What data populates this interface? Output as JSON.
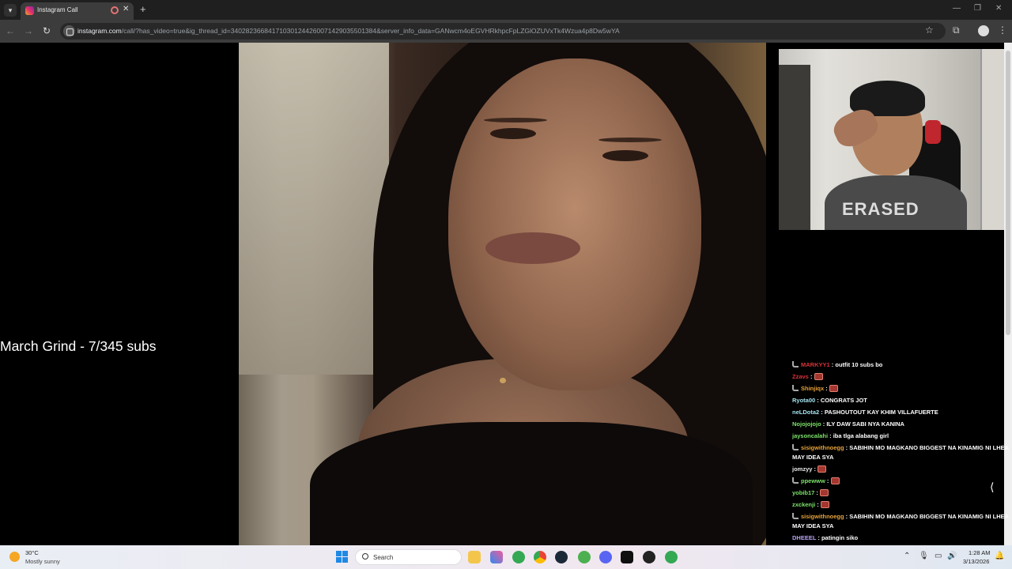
{
  "browser": {
    "tab_title": "Instagram Call",
    "url_host": "instagram.com",
    "url_path": "/call/?has_video=true&ig_thread_id=340282366841710301244260071429035501384&server_info_data=GANwcm4oEGVHRkhpcFpLZGlOZUVxTk4Wzua4p8Dw5wYA"
  },
  "stream": {
    "overlay_text": "March Grind - 7/345 subs"
  },
  "chat": {
    "messages": [
      {
        "user": "MARKYY1",
        "color": "#d9323a",
        "badge": true,
        "text": "outfit 10 subs bo",
        "emote": false
      },
      {
        "user": "Zzavs",
        "color": "#d9323a",
        "badge": false,
        "text": "",
        "emote": true
      },
      {
        "user": "Shinjiqx",
        "color": "#e8a33a",
        "badge": true,
        "text": "",
        "emote": true
      },
      {
        "user": "Ryota00",
        "color": "#a4e3f0",
        "badge": false,
        "text": "CONGRATS JOT",
        "emote": false
      },
      {
        "user": "neLDota2",
        "color": "#a4e3f0",
        "badge": false,
        "text": "PASHOUTOUT KAY KHIM VILLAFUERTE",
        "emote": false
      },
      {
        "user": "Nojojojojo",
        "color": "#7de36a",
        "badge": false,
        "text": "ILY DAW SABI NYA KANINA",
        "emote": false
      },
      {
        "user": "jaysoncalahi",
        "color": "#7de36a",
        "badge": false,
        "text": "iba tlga alabang girl",
        "emote": false
      },
      {
        "user": "sisigwithnoegg",
        "color": "#e8a33a",
        "badge": true,
        "text": "SABIHIN MO MAGKANO BIGGEST NA KINAMIG NI LHEA MAY IDEA SYA",
        "emote": false,
        "wrap": true
      },
      {
        "user": "jomzyy",
        "color": "#e8e8e8",
        "badge": false,
        "text": "",
        "emote": true
      },
      {
        "user": "ppewww",
        "color": "#7de36a",
        "badge": true,
        "text": "",
        "emote": true
      },
      {
        "user": "yobib17",
        "color": "#7de36a",
        "badge": false,
        "text": "",
        "emote": true
      },
      {
        "user": "zxckenji",
        "color": "#7de36a",
        "badge": false,
        "text": "",
        "emote": true
      },
      {
        "user": "sisigwithnoegg",
        "color": "#e8a33a",
        "badge": true,
        "text": "SABIHIN MO MAGKANO BIGGEST NA KINAMIG NI LHEA MAY IDEA SYA",
        "emote": false,
        "wrap": true
      },
      {
        "user": "DHEEEL",
        "color": "#b7a4f5",
        "badge": false,
        "text": "patingin siko",
        "emote": false
      }
    ]
  },
  "pip": {
    "shirt_text": "ERASED"
  },
  "taskbar": {
    "weather_temp": "30°C",
    "weather_desc": "Mostly sunny",
    "search_label": "Search",
    "clock_time": "1:28 AM",
    "clock_date": "3/13/2026"
  }
}
